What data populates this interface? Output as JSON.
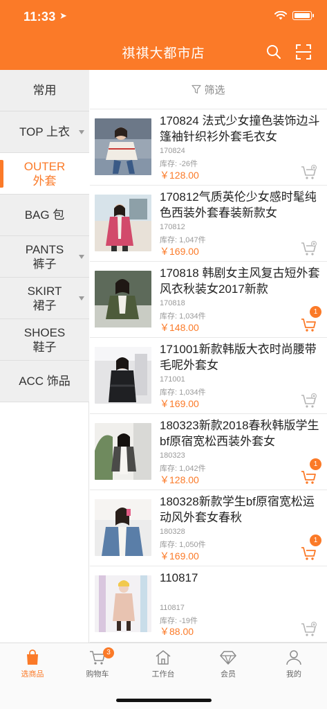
{
  "status_bar": {
    "time": "11:33"
  },
  "header": {
    "title": "祺祺大都市店"
  },
  "sidebar": {
    "items": [
      {
        "line1": "常用",
        "line2": ""
      },
      {
        "line1": "TOP 上衣",
        "line2": ""
      },
      {
        "line1": "OUTER",
        "line2": "外套"
      },
      {
        "line1": "BAG 包",
        "line2": ""
      },
      {
        "line1": "PANTS",
        "line2": "裤子"
      },
      {
        "line1": "SKIRT",
        "line2": "裙子"
      },
      {
        "line1": "SHOES",
        "line2": "鞋子"
      },
      {
        "line1": "ACC 饰品",
        "line2": ""
      }
    ]
  },
  "filter": {
    "label": "筛选"
  },
  "products": [
    {
      "title": "170824 法式少女撞色装饰边斗篷袖针织衫外套毛衣女",
      "code": "170824",
      "stock": "库存: -26件",
      "price": "￥128.00",
      "badge": ""
    },
    {
      "title": "170812气质英伦少女感时髦纯色西装外套春装新款女",
      "code": "170812",
      "stock": "库存: 1,047件",
      "price": "￥169.00",
      "badge": ""
    },
    {
      "title": "170818 韩剧女主风复古短外套风衣秋装女2017新款",
      "code": "170818",
      "stock": "库存: 1,034件",
      "price": "￥148.00",
      "badge": "1"
    },
    {
      "title": "171001新款韩版大衣时尚腰带毛呢外套女",
      "code": "171001",
      "stock": "库存: 1,034件",
      "price": "￥169.00",
      "badge": ""
    },
    {
      "title": "180323新款2018春秋韩版学生bf原宿宽松西装外套女",
      "code": "180323",
      "stock": "库存: 1,042件",
      "price": "￥128.00",
      "badge": "1"
    },
    {
      "title": "180328新款学生bf原宿宽松运动风外套女春秋",
      "code": "180328",
      "stock": "库存: 1,050件",
      "price": "￥169.00",
      "badge": "1"
    },
    {
      "title": "110817",
      "code": "110817",
      "stock": "库存: -19件",
      "price": "￥88.00",
      "badge": ""
    }
  ],
  "tabbar": {
    "tabs": [
      {
        "label": "选商品",
        "icon": "bag-icon"
      },
      {
        "label": "购物车",
        "icon": "cart-icon",
        "badge": "3"
      },
      {
        "label": "工作台",
        "icon": "house-icon"
      },
      {
        "label": "会员",
        "icon": "diamond-icon"
      },
      {
        "label": "我的",
        "icon": "person-icon"
      }
    ]
  },
  "colors": {
    "accent": "#fb7a28",
    "sidebar_bg": "#efefef"
  }
}
